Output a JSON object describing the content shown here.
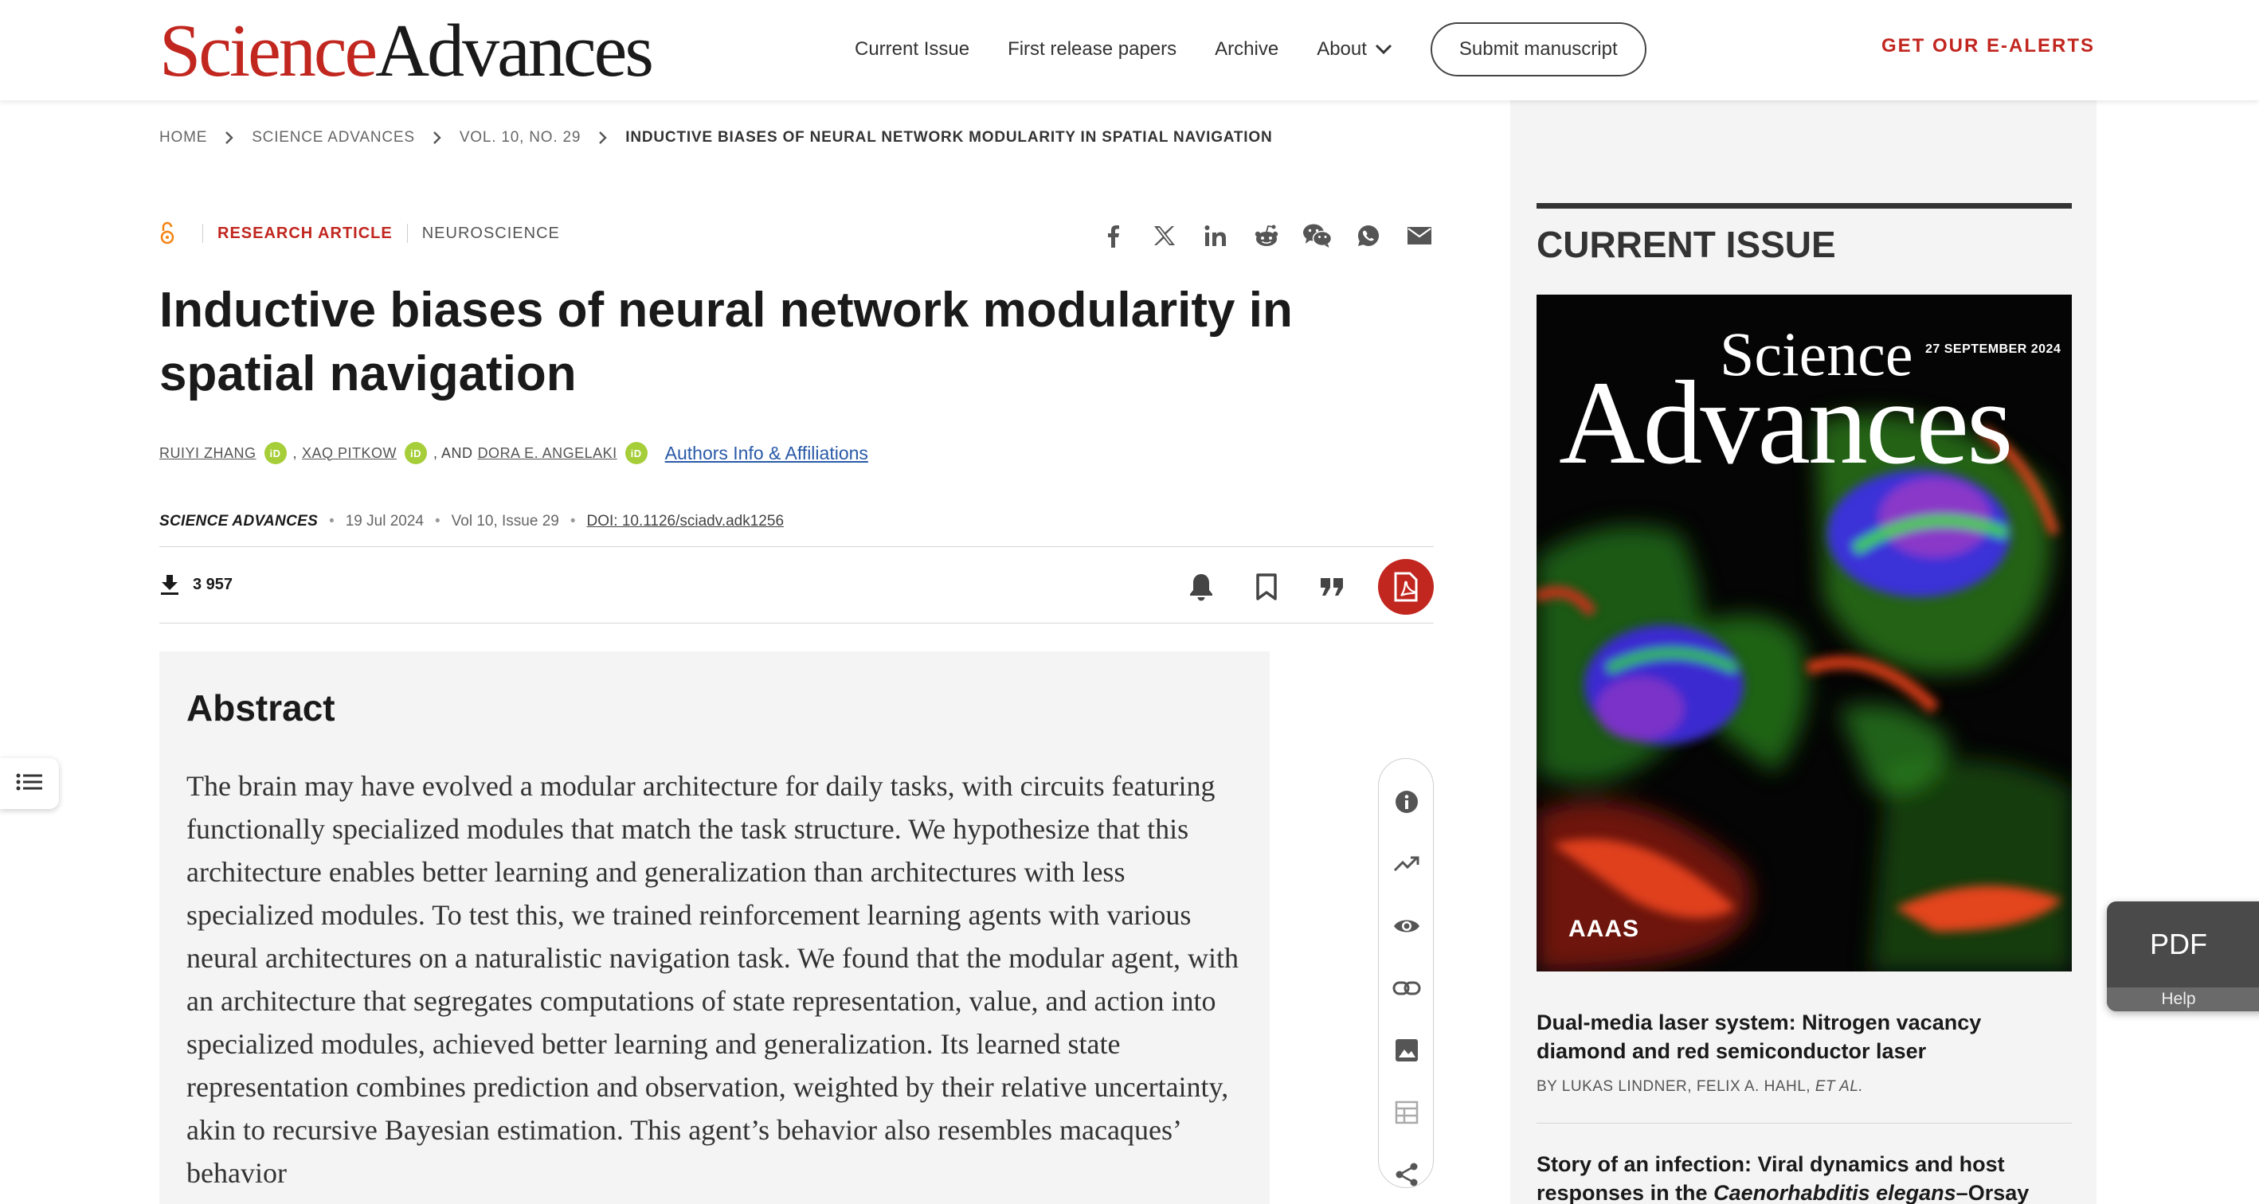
{
  "header": {
    "logo_part1": "Science",
    "logo_part2": "Advances",
    "nav": [
      "Current Issue",
      "First release papers",
      "Archive",
      "About"
    ],
    "submit_label": "Submit manuscript",
    "ealerts_label": "GET OUR E-ALERTS",
    "brand_color": "#c1261f"
  },
  "breadcrumb": [
    "HOME",
    "SCIENCE ADVANCES",
    "VOL. 10, NO. 29",
    "INDUCTIVE BIASES OF NEURAL NETWORK MODULARITY IN SPATIAL NAVIGATION"
  ],
  "article": {
    "type": "RESEARCH ARTICLE",
    "subject": "NEUROSCIENCE",
    "share_icons": [
      "facebook-icon",
      "x-icon",
      "linkedin-icon",
      "reddit-icon",
      "wechat-icon",
      "whatsapp-icon",
      "email-icon"
    ],
    "title": "Inductive biases of neural network modularity in spatial navigation",
    "authors": [
      "RUIYI ZHANG",
      "XAQ PITKOW",
      "DORA E. ANGELAKI"
    ],
    "author_sep_1": ",",
    "author_sep_2": ", AND",
    "affiliations_link": "Authors Info & Affiliations",
    "journal": "SCIENCE ADVANCES",
    "date": "19 Jul 2024",
    "volume": "Vol 10, Issue 29",
    "doi": "DOI: 10.1126/sciadv.adk1256",
    "downloads": "3 957",
    "toolbar_icons": [
      "bell-icon",
      "bookmark-icon",
      "quote-icon",
      "pdf-icon"
    ]
  },
  "abstract": {
    "heading": "Abstract",
    "text": "The brain may have evolved a modular architecture for daily tasks, with circuits featuring functionally specialized modules that match the task structure. We hy­pothesize that this architecture enables better learning and generalization than architectures with less specialized modules. To test this, we trained reinforcement learning agents with various neural architectures on a naturalistic navigation task. We found that the modular agent, with an architecture that segregates computa­tions of state representation, value, and action into specialized modules, achieved better learning and generalization. Its learned state representation combines pre­diction and observation, weighted by their relative uncertainty, akin to recursive Bayesian estimation. This agent’s behavior also resembles macaques’ behavior"
  },
  "rail_icons": [
    "info-icon",
    "metrics-icon",
    "eye-icon",
    "link-icon",
    "image-icon",
    "table-icon",
    "share-icon"
  ],
  "sidebar": {
    "heading": "CURRENT ISSUE",
    "cover": {
      "science": "Science",
      "advances": "Advances",
      "date": "27 SEPTEMBER 2024",
      "publisher": "AAAS"
    },
    "articles": [
      {
        "title": "Dual-media laser system: Nitrogen vacancy diamond and red semiconductor laser",
        "byline": "BY LUKAS LINDNER, FELIX A. HAHL,",
        "etal": "ET AL."
      },
      {
        "title_a": "Story of an infection: Viral dynamics and host responses in the ",
        "title_b": "Caenorhabditis elegans",
        "title_c": "–Orsay virus"
      }
    ]
  },
  "pdf_widget": {
    "label": "PDF",
    "help": "Help"
  }
}
